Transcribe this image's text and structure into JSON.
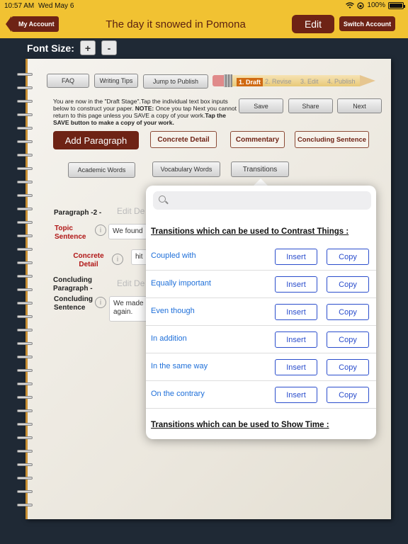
{
  "status_bar": {
    "time": "10:57 AM",
    "date": "Wed May 6",
    "battery": "100%"
  },
  "nav": {
    "back_label": "My Account",
    "title": "The day it snowed in Pomona",
    "edit_label": "Edit",
    "switch_label": "Switch Account"
  },
  "font_size": {
    "label": "Font Size:",
    "increase": "+",
    "decrease": "-"
  },
  "toolbar": {
    "faq": "FAQ",
    "writing_tips": "Writing Tips",
    "jump": "Jump to Publish"
  },
  "stages": [
    "1. Draft",
    "2. Revise",
    "3. Edit",
    "4. Publish"
  ],
  "actions": {
    "save": "Save",
    "share": "Share",
    "next": "Next"
  },
  "notice": {
    "text": "You are now in the \"Draft Stage\".Tap the individual text box inputs below to construct your paper. ",
    "note_label": "NOTE:",
    "note_text": " Once you tap Next you cannot return to this page unless you SAVE a copy of your work.",
    "bold_tail": "Tap the SAVE button to make a copy of your work."
  },
  "buttons": {
    "add_paragraph": "Add Paragraph",
    "concrete_detail": "Concrete Detail",
    "commentary": "Commentary",
    "concluding_sentence": "Concluding Sentence",
    "academic_words": "Academic Words",
    "vocabulary_words": "Vocabulary Words",
    "transitions": "Transitions"
  },
  "paragraph": {
    "heading": "Paragraph -2  -",
    "edit_placeholder": "Edit De",
    "topic_label": "Topic Sentence",
    "topic_value": "We found",
    "concrete_label": "Concrete Detail",
    "concrete_value": "hit",
    "concluding_heading": "Concluding Paragraph  -",
    "concluding_label": "Concluding Sentence",
    "concluding_value_1": "We made",
    "concluding_value_2": "again.",
    "info_icon": "i"
  },
  "popover": {
    "search_placeholder": "",
    "section_contrast": "Transitions which can be used to Contrast Things :",
    "section_time": "Transitions which can be used to Show Time :",
    "insert_label": "Insert",
    "copy_label": "Copy",
    "items": [
      "Coupled with",
      "Equally important",
      "Even though",
      "In addition",
      "In the same way",
      "On the contrary"
    ]
  },
  "colors": {
    "nav_bar": "#f1c232",
    "brand_dark": "#6e2315",
    "link_blue": "#1e6fd9",
    "background": "#1f2935"
  }
}
